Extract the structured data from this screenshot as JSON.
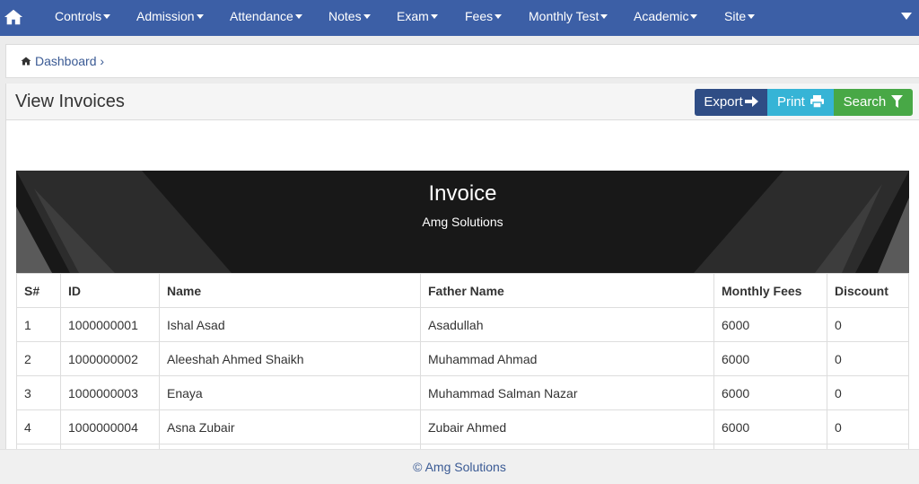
{
  "colors": {
    "navbar": "#3c5fa6",
    "export_button": "#2f4d85",
    "print_button": "#36b4d6",
    "search_button": "#48a846",
    "banner": "#181818",
    "link": "#3a5a94"
  },
  "navbar": {
    "home_icon": "home-icon",
    "items": [
      {
        "label": "Controls"
      },
      {
        "label": "Admission"
      },
      {
        "label": "Attendance"
      },
      {
        "label": "Notes"
      },
      {
        "label": "Exam"
      },
      {
        "label": "Fees"
      },
      {
        "label": "Monthly Test"
      },
      {
        "label": "Academic"
      },
      {
        "label": "Site"
      }
    ],
    "right_icon": "caret-down-icon"
  },
  "breadcrumb": {
    "icon": "home-icon",
    "link": "Dashboard",
    "separator": "›"
  },
  "page": {
    "title": "View Invoices",
    "buttons": {
      "export": {
        "label": "Export",
        "icon": "sign-out-icon"
      },
      "print": {
        "label": "Print",
        "icon": "print-icon"
      },
      "search": {
        "label": "Search",
        "icon": "filter-icon"
      }
    }
  },
  "invoice": {
    "title": "Invoice",
    "subtitle": "Amg Solutions"
  },
  "table": {
    "headers": [
      "S#",
      "ID",
      "Name",
      "Father Name",
      "Monthly Fees",
      "Discount"
    ],
    "rows": [
      [
        "1",
        "1000000001",
        "Ishal Asad",
        "Asadullah",
        "6000",
        "0"
      ],
      [
        "2",
        "1000000002",
        "Aleeshah Ahmed Shaikh",
        "Muhammad Ahmad",
        "6000",
        "0"
      ],
      [
        "3",
        "1000000003",
        "Enaya",
        "Muhammad Salman Nazar",
        "6000",
        "0"
      ],
      [
        "4",
        "1000000004",
        "Asna Zubair",
        "Zubair Ahmed",
        "6000",
        "0"
      ],
      [
        "",
        "",
        "",
        "",
        "",
        ""
      ]
    ]
  },
  "footer": {
    "text": "© Amg Solutions"
  }
}
